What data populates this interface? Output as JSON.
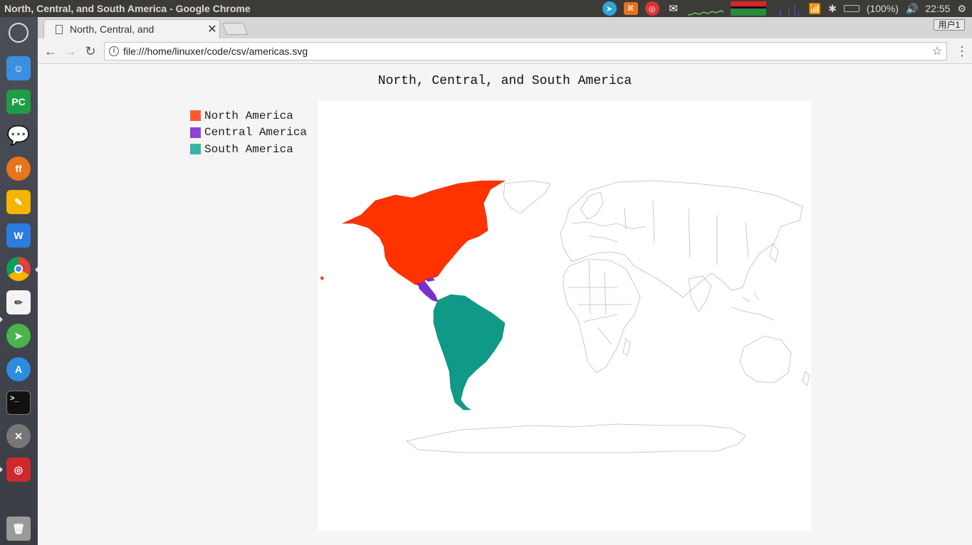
{
  "window": {
    "title": "North, Central, and South America - Google Chrome"
  },
  "tray": {
    "battery": "(100%)",
    "clock": "22:55",
    "user": "用户1"
  },
  "browser": {
    "tab_title": "North, Central, and South America",
    "tab_title_visible": "North, Central, and",
    "url": "file:///home/linuxer/code/csv/americas.svg"
  },
  "chart_data": {
    "type": "map",
    "title": "North, Central, and South America",
    "series": [
      {
        "name": "North America",
        "color": "#ff3300"
      },
      {
        "name": "Central America",
        "color": "#7a2fd0"
      },
      {
        "name": "South America",
        "color": "#0e9a86"
      }
    ],
    "legend_colors": [
      "#ff5a36",
      "#8a44d6",
      "#3ab3a5"
    ],
    "legend_placement": "top-left",
    "basemap": "world outline"
  },
  "icons": {
    "launcher": [
      "ubuntu-dash-icon",
      "files-icon",
      "pycharm-icon",
      "wechat-icon",
      "firefox-icon",
      "paint-icon",
      "wps-writer-icon",
      "chrome-icon",
      "text-editor-icon",
      "telegram-icon",
      "app-store-icon",
      "terminal-icon",
      "settings-icon",
      "netease-music-icon",
      "trash-icon"
    ]
  }
}
